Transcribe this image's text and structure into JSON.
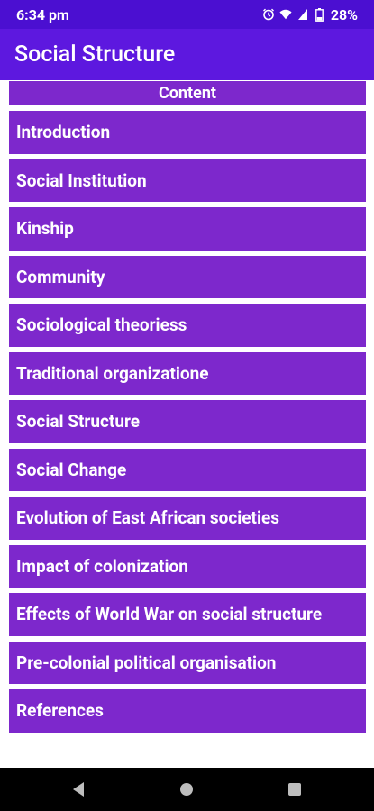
{
  "status_bar": {
    "time": "6:34 pm",
    "battery": "28%",
    "icons": [
      "alarm-icon",
      "wifi-icon",
      "signal-icon",
      "battery-icon"
    ]
  },
  "app_bar": {
    "title": "Social Structure"
  },
  "content": {
    "header": "Content",
    "items": [
      {
        "label": "Introduction"
      },
      {
        "label": "Social Institution"
      },
      {
        "label": "Kinship"
      },
      {
        "label": "Community"
      },
      {
        "label": "Sociological theoriess"
      },
      {
        "label": "Traditional organizatione"
      },
      {
        "label": "Social Structure"
      },
      {
        "label": "Social Change"
      },
      {
        "label": "Evolution of East African societies"
      },
      {
        "label": "Impact of colonization"
      },
      {
        "label": "Effects of World War on social structure"
      },
      {
        "label": "Pre-colonial political organisation"
      },
      {
        "label": "References"
      }
    ]
  },
  "nav_bar": {
    "buttons": [
      "back-icon",
      "home-icon",
      "recents-icon"
    ]
  },
  "colors": {
    "status_bar": "#4b0fd1",
    "app_bar": "#5d18df",
    "list_item": "#7d28cc",
    "nav_bar": "#000000"
  }
}
